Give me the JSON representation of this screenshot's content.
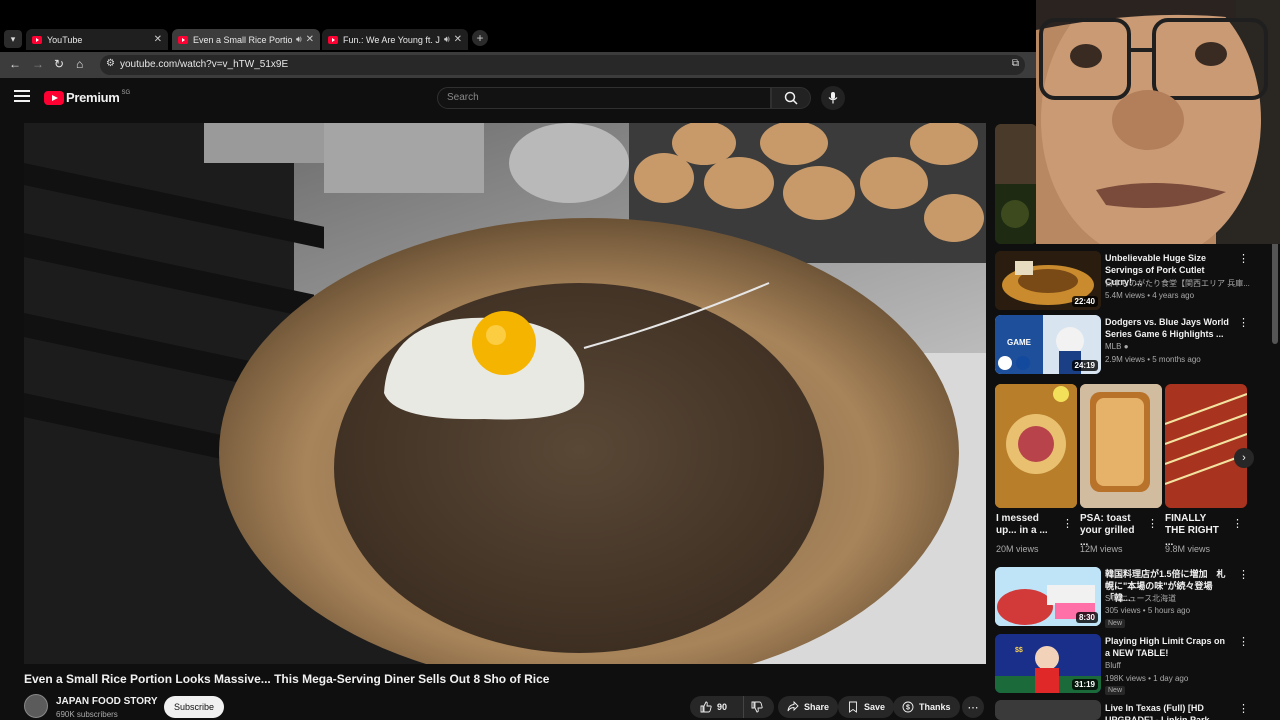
{
  "browser": {
    "tabs": [
      {
        "label": "YouTube"
      },
      {
        "label": "Even a Small Rice Portion L"
      },
      {
        "label": "Fun.: We Are Young ft. Jane"
      }
    ],
    "url": "youtube.com/watch?v=v_hTW_51x9E"
  },
  "header": {
    "logo": "Premium",
    "logo_sup": "SG",
    "search_placeholder": "Search"
  },
  "video": {
    "title": "Even a Small Rice Portion Looks Massive... This Mega-Serving Diner Sells Out 8 Sho of Rice",
    "channel": "JAPAN FOOD STORY",
    "subscribers": "690K subscribers",
    "subscribe_label": "Subscribe",
    "likes": "90",
    "share_label": "Share",
    "save_label": "Save",
    "thanks_label": "Thanks"
  },
  "sidebar": {
    "videos": [
      {
        "title": "Unbelievable Huge Size Servings of Pork Cutlet Curry! ...",
        "channel": "日本ものがたり食堂【関西エリア 兵庫...",
        "meta": "5.4M views • 4 years ago",
        "duration": "22:40"
      },
      {
        "title": "Dodgers vs. Blue Jays World Series Game 6 Highlights ...",
        "channel": "MLB",
        "meta": "2.9M views • 5 months ago",
        "duration": "24:19"
      }
    ],
    "shorts": [
      {
        "title": "I messed up... in a ...",
        "views": "20M views"
      },
      {
        "title": "PSA: toast your grilled ...",
        "views": "12M views"
      },
      {
        "title": "FINALLY THE RIGHT ...",
        "views": "9.8M views"
      }
    ],
    "more_videos": [
      {
        "title": "韓国料理店が1.5倍に増加　札幌に\"本場の味\"が続々登場「韓...",
        "channel": "STVニュース北海道",
        "meta": "305 views • 5 hours ago",
        "badge": "New",
        "duration": "8:30"
      },
      {
        "title": "Playing High Limit Craps on a NEW TABLE!",
        "channel": "Bluff",
        "meta": "198K views • 1 day ago",
        "badge": "New",
        "duration": "31:19"
      },
      {
        "title": "Live In Texas (Full) [HD UPGRADE] - Linkin Park",
        "channel": "",
        "meta": "",
        "badge": "",
        "duration": ""
      }
    ]
  },
  "colors": {
    "brand": "#ff0033",
    "background": "#0f0f0f"
  }
}
